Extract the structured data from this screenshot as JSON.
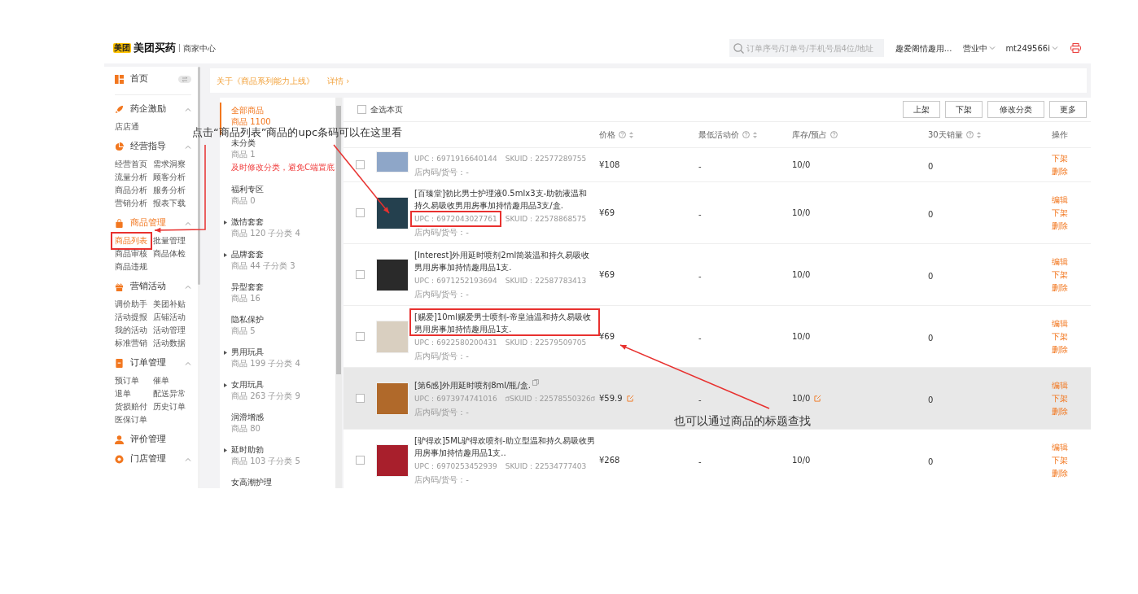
{
  "header": {
    "logo_badge": "美团",
    "logo": "美团买药",
    "subtitle": "商家中心",
    "search": {
      "placeholder": "订单序号/订单号/手机号后4位/地址"
    },
    "store": "趣爱阁情趣用...",
    "status": "营业中",
    "account": "mt249566i"
  },
  "sidebar": {
    "sections": [
      {
        "kind": "home",
        "title": "首页",
        "selected": false
      },
      {
        "kind": "group",
        "title": "药企激励",
        "selected": false,
        "expanded": true,
        "items": [
          {
            "label": "店店通",
            "selected": false
          }
        ]
      },
      {
        "kind": "group",
        "title": "经营指导",
        "selected": false,
        "expanded": true,
        "items": [
          {
            "label": "经营首页",
            "selected": false
          },
          {
            "label": "需求洞察",
            "selected": false
          },
          {
            "label": "流量分析",
            "selected": false
          },
          {
            "label": "顾客分析",
            "selected": false
          },
          {
            "label": "商品分析",
            "selected": false
          },
          {
            "label": "服务分析",
            "selected": false
          },
          {
            "label": "营销分析",
            "selected": false
          },
          {
            "label": "报表下载",
            "selected": false
          }
        ]
      },
      {
        "kind": "group",
        "title": "商品管理",
        "selected": true,
        "expanded": true,
        "items": [
          {
            "label": "商品列表",
            "selected": true
          },
          {
            "label": "批量管理",
            "selected": false
          },
          {
            "label": "商品审核",
            "selected": false
          },
          {
            "label": "商品体检",
            "selected": false
          },
          {
            "label": "商品违规",
            "selected": false
          }
        ]
      },
      {
        "kind": "group",
        "title": "营销活动",
        "selected": false,
        "expanded": true,
        "items": [
          {
            "label": "调价助手",
            "selected": false
          },
          {
            "label": "美团补贴",
            "selected": false
          },
          {
            "label": "活动提报",
            "selected": false
          },
          {
            "label": "店铺活动",
            "selected": false
          },
          {
            "label": "我的活动",
            "selected": false
          },
          {
            "label": "活动管理",
            "selected": false
          },
          {
            "label": "标准营销",
            "selected": false
          },
          {
            "label": "活动数据",
            "selected": false
          }
        ]
      },
      {
        "kind": "group",
        "title": "订单管理",
        "selected": false,
        "expanded": true,
        "items": [
          {
            "label": "预订单",
            "selected": false
          },
          {
            "label": "催单",
            "selected": false
          },
          {
            "label": "退单",
            "selected": false
          },
          {
            "label": "配送异常",
            "selected": false
          },
          {
            "label": "货损赔付",
            "selected": false
          },
          {
            "label": "历史订单",
            "selected": false
          },
          {
            "label": "医保订单",
            "selected": false
          }
        ]
      },
      {
        "kind": "link",
        "title": "评价管理",
        "selected": false
      },
      {
        "kind": "group",
        "title": "门店管理",
        "selected": false,
        "expanded": true
      }
    ]
  },
  "notice": {
    "text": "关于《商品系列能力上线》",
    "link": "详情 ›"
  },
  "categories": [
    {
      "name": "全部商品",
      "count": "商品 1100",
      "has_children": false,
      "selected": true
    },
    {
      "name": "未分类",
      "count": "商品 1",
      "has_children": false,
      "selected": false,
      "warning": "及时修改分类，避免C端置底"
    },
    {
      "name": "福利专区",
      "count": "商品 0",
      "has_children": false,
      "selected": false
    },
    {
      "name": "激情套套",
      "count": "商品 120 子分类 4",
      "has_children": true,
      "selected": false
    },
    {
      "name": "品牌套套",
      "count": "商品 44 子分类 3",
      "has_children": true,
      "selected": false
    },
    {
      "name": "异型套套",
      "count": "商品 16",
      "has_children": false,
      "selected": false
    },
    {
      "name": "隐私保护",
      "count": "商品 5",
      "has_children": false,
      "selected": false
    },
    {
      "name": "男用玩具",
      "count": "商品 199 子分类 4",
      "has_children": true,
      "selected": false
    },
    {
      "name": "女用玩具",
      "count": "商品 263 子分类 9",
      "has_children": true,
      "selected": false
    },
    {
      "name": "润滑增感",
      "count": "商品 80",
      "has_children": false,
      "selected": false
    },
    {
      "name": "延时助勃",
      "count": "商品 103 子分类 5",
      "has_children": true,
      "selected": false
    },
    {
      "name": "女高潮护理",
      "has_children": false,
      "selected": false
    }
  ],
  "toolbar": {
    "select_all": {
      "label": "全选本页",
      "checked": false
    },
    "buttons": [
      "上架",
      "下架",
      "修改分类",
      "更多"
    ]
  },
  "table": {
    "columns": [
      {
        "label": "价格",
        "help": true,
        "sortable": true
      },
      {
        "label": "最低活动价",
        "help": true,
        "sortable": true
      },
      {
        "label": "库存/预占",
        "help": true,
        "sortable": false
      },
      {
        "label": "30天销量",
        "help": true,
        "sortable": true
      },
      {
        "label": "操作",
        "help": false,
        "sortable": false
      }
    ],
    "rows": [
      {
        "checked": false,
        "highlighted": false,
        "upc": "UPC：6971916640144",
        "skuid": "SKUID：22577289755",
        "code": "店内码/货号：-",
        "price": "¥108",
        "min_price": "-",
        "stock": "10/0",
        "sales": "0",
        "actions": [
          "下架",
          "删除"
        ]
      },
      {
        "checked": false,
        "highlighted": false,
        "title": "[百臻堂]勃比男士护理液0.5mlx3支-助勃液温和持久易吸收男用房事加持情趣用品3支/盒.",
        "upc": "UPC：6972043027761",
        "skuid": "SKUID：22578868575",
        "code": "店内码/货号：-",
        "price": "¥69",
        "min_price": "-",
        "stock": "10/0",
        "sales": "0",
        "actions": [
          "编辑",
          "下架",
          "删除"
        ]
      },
      {
        "checked": false,
        "highlighted": false,
        "title": "[Interest]外用延时喷剂2ml简装温和持久易吸收男用房事加持情趣用品1支.",
        "upc": "UPC：6971252193694",
        "skuid": "SKUID：22587783413",
        "code": "店内码/货号：-",
        "price": "¥69",
        "min_price": "-",
        "stock": "10/0",
        "sales": "0",
        "actions": [
          "编辑",
          "下架",
          "删除"
        ]
      },
      {
        "checked": false,
        "highlighted": false,
        "title": "[赐爱]10ml赐爱男士喷剂-帝皇油温和持久易吸收男用房事加持情趣用品1支.",
        "upc": "UPC：6922580200431",
        "skuid": "SKUID：22579509705",
        "code": "店内码/货号：-",
        "price": "¥69",
        "min_price": "-",
        "stock": "10/0",
        "sales": "0",
        "actions": [
          "编辑",
          "下架",
          "删除"
        ]
      },
      {
        "checked": false,
        "highlighted": true,
        "title": "[第6感]外用延时喷剂8ml/瓶/盒.",
        "upc": "UPC：6973974741016",
        "skuid": "SKUID：22578550326",
        "code": "店内码/货号：-",
        "price": "¥59.9",
        "min_price": "-",
        "stock": "10/0",
        "sales": "0",
        "actions": [
          "编辑",
          "下架",
          "删除"
        ]
      },
      {
        "checked": false,
        "highlighted": false,
        "title": "[驴得欢]5ML驴得欢喷剂-助立型温和持久易吸收男用房事加持情趣用品1支..",
        "upc": "UPC：6970253452939",
        "skuid": "SKUID：22534777403",
        "code": "店内码/货号：-",
        "price": "¥268",
        "min_price": "-",
        "stock": "10/0",
        "sales": "0",
        "actions": [
          "编辑",
          "下架",
          "删除"
        ]
      }
    ]
  },
  "annotations": [
    "点击“商品列表”商品的upc条码可以在这里看",
    "也可以通过商品的标题查找"
  ]
}
